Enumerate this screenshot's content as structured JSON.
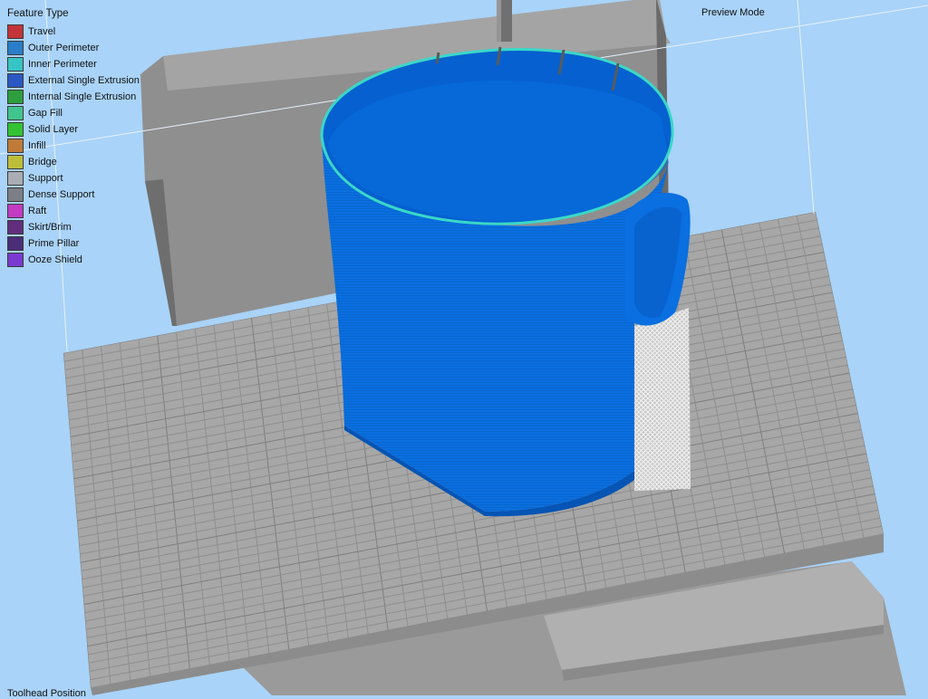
{
  "legend": {
    "title": "Feature Type",
    "items": [
      {
        "label": "Travel",
        "color": "#c3333a"
      },
      {
        "label": "Outer Perimeter",
        "color": "#2b7dc9"
      },
      {
        "label": "Inner Perimeter",
        "color": "#36c4c4"
      },
      {
        "label": "External Single Extrusion",
        "color": "#2a59c4"
      },
      {
        "label": "Internal Single Extrusion",
        "color": "#2e9e3e"
      },
      {
        "label": "Gap Fill",
        "color": "#41c48e"
      },
      {
        "label": "Solid Layer",
        "color": "#33c233"
      },
      {
        "label": "Infill",
        "color": "#c07a3a"
      },
      {
        "label": "Bridge",
        "color": "#bdbd3a"
      },
      {
        "label": "Support",
        "color": "#a9adb4"
      },
      {
        "label": "Dense Support",
        "color": "#7c8086"
      },
      {
        "label": "Raft",
        "color": "#c23bc2"
      },
      {
        "label": "Skirt/Brim",
        "color": "#612e7d"
      },
      {
        "label": "Prime Pillar",
        "color": "#4a2e78"
      },
      {
        "label": "Ooze Shield",
        "color": "#7a3ad0"
      }
    ]
  },
  "view": {
    "mode": "Preview Mode",
    "position_text": "Toolhead Position"
  },
  "colors": {
    "background": "#a9d3f8",
    "bed": "#a7a7a7",
    "bed_grid": "#8c8c8c",
    "model": "#0a6fe0",
    "model_top_edge": "#3ad8c8",
    "support": "#d2d2d2",
    "machine": "#8a8a8a"
  }
}
